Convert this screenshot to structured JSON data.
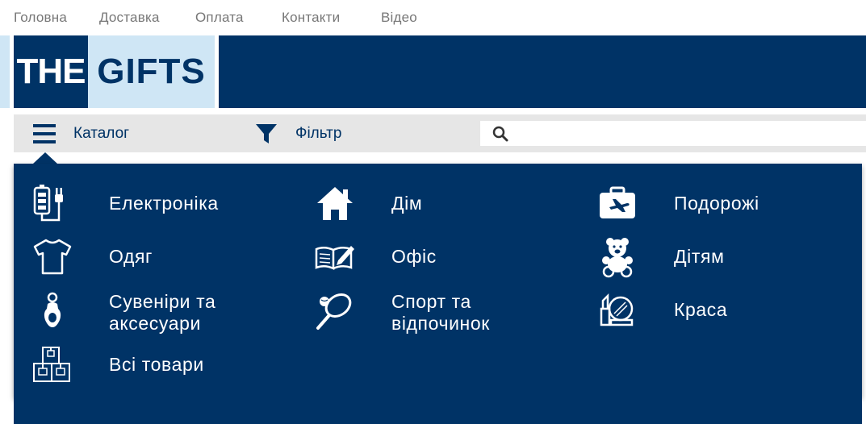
{
  "topnav": {
    "items": [
      "Головна",
      "Доставка",
      "Оплата",
      "Контакти",
      "Відео"
    ]
  },
  "logo": {
    "part1": "THE",
    "part2": "GIFTS"
  },
  "toolbar": {
    "catalog_label": "Каталог",
    "filter_label": "Фільтр",
    "search_placeholder": ""
  },
  "catalog": {
    "items": [
      {
        "label_lines": [
          "Електроніка"
        ],
        "icon": "battery-plug-icon"
      },
      {
        "label_lines": [
          "Дім"
        ],
        "icon": "house-icon"
      },
      {
        "label_lines": [
          "Подорожі"
        ],
        "icon": "suitcase-plane-icon"
      },
      {
        "label_lines": [
          "Одяг"
        ],
        "icon": "tshirt-icon"
      },
      {
        "label_lines": [
          "Офіс"
        ],
        "icon": "book-pen-icon"
      },
      {
        "label_lines": [
          "Дітям"
        ],
        "icon": "teddy-bear-icon"
      },
      {
        "label_lines": [
          "Сувеніри та",
          "аксесуари"
        ],
        "icon": "keychain-icon"
      },
      {
        "label_lines": [
          "Спорт та",
          "відпочинок"
        ],
        "icon": "tennis-racket-icon"
      },
      {
        "label_lines": [
          "Краса"
        ],
        "icon": "lipstick-mirror-icon"
      },
      {
        "label_lines": [
          "Всі товари"
        ],
        "icon": "boxes-icon"
      }
    ]
  },
  "colors": {
    "brand_dark": "#003366",
    "brand_light": "#cfe6f5",
    "toolbar_bg": "#e6e6e6",
    "nav_text": "#777777"
  }
}
